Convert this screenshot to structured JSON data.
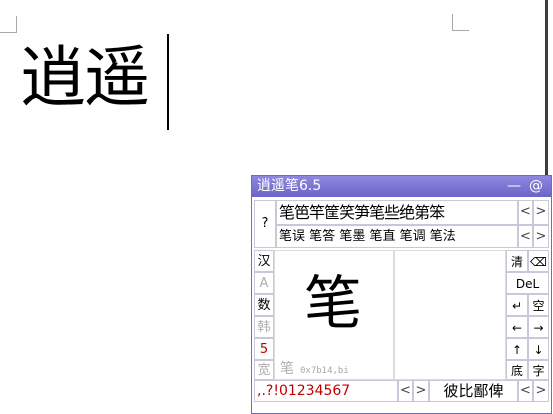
{
  "document": {
    "text": "逍遥"
  },
  "ime": {
    "title": "逍遥笔6.5",
    "minimize_label": "—",
    "help_label": "@",
    "question_label": "?",
    "candidates_row1": [
      "笔",
      "笆",
      "竿",
      "筐",
      "笑",
      "笋",
      "笔",
      "些",
      "绝",
      "第",
      "笨"
    ],
    "candidates_row2": [
      "笔误",
      "笔答",
      "笔墨",
      "笔直",
      "笔调",
      "笔法"
    ],
    "left_column": [
      {
        "label": "汉",
        "style": "normal"
      },
      {
        "label": "A",
        "style": "grey"
      },
      {
        "label": "数",
        "style": "normal"
      },
      {
        "label": "韩",
        "style": "grey"
      },
      {
        "label": "5",
        "style": "red"
      },
      {
        "label": "宽",
        "style": "grey"
      }
    ],
    "right_buttons": {
      "clear": "清",
      "backspace": "⌫",
      "delete": "DeL",
      "enter": "↵",
      "space": "空",
      "left": "←",
      "right": "→",
      "up": "↑",
      "down": "↓",
      "bottom": "底",
      "char": "字"
    },
    "recognized_char": "笔",
    "recognized_small": "笔",
    "code": "0x7b14,bi",
    "punct_row": ",.?!01234567",
    "bottom_candidates": "彼比鄙俾",
    "arrow_left": "<",
    "arrow_right": ">"
  }
}
